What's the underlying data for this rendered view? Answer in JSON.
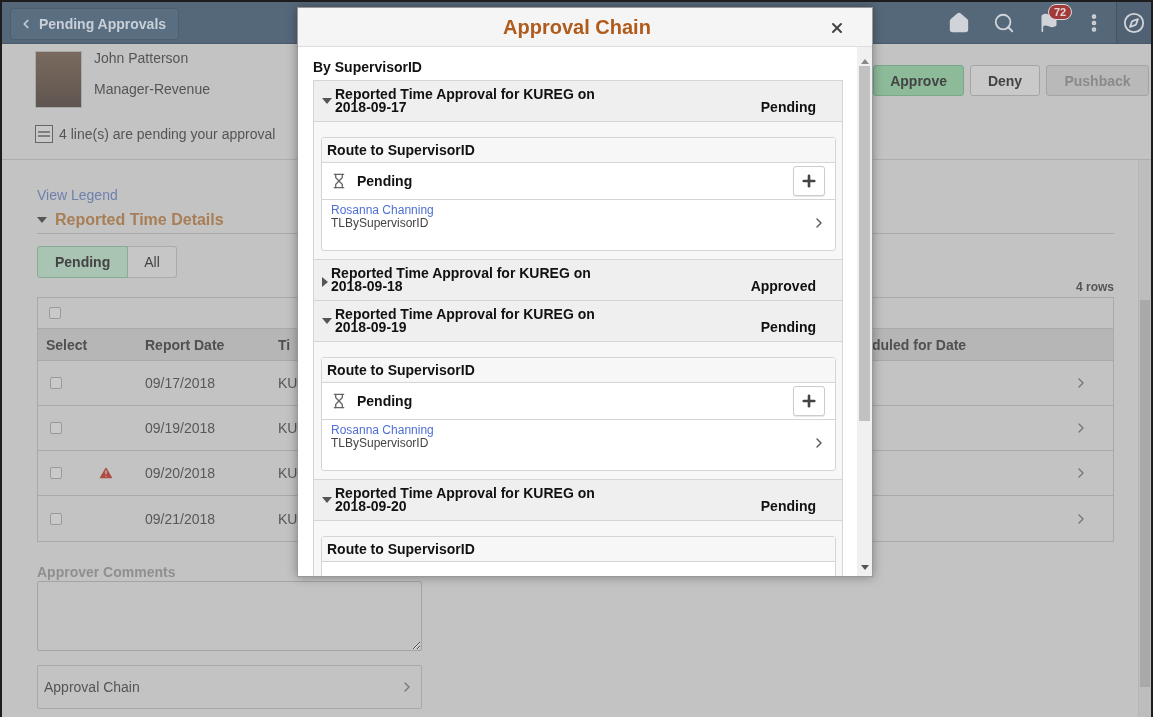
{
  "header": {
    "back_label": "Pending Approvals",
    "notification_count": "72"
  },
  "employee": {
    "name": "John Patterson",
    "title": "Manager-Revenue"
  },
  "actions": [
    {
      "label": "Approve",
      "kind": "primary"
    },
    {
      "label": "Deny",
      "kind": "default"
    },
    {
      "label": "Pushback",
      "kind": "disabled"
    }
  ],
  "pending_note": "4 line(s) are pending your approval",
  "legend_link": "View Legend",
  "section": {
    "title": "Reported Time Details",
    "expanded": true
  },
  "filter": [
    {
      "label": "Pending",
      "selected": true
    },
    {
      "label": "All",
      "selected": false
    }
  ],
  "row_count": "4 rows",
  "table": {
    "all_checked": false,
    "columns": [
      "Select",
      "Report Date",
      "Ti",
      "duled for Date"
    ],
    "rows": [
      {
        "checked": false,
        "warning": false,
        "report_date": "09/17/2018",
        "column_3": "KU"
      },
      {
        "checked": false,
        "warning": false,
        "report_date": "09/19/2018",
        "column_3": "KU"
      },
      {
        "checked": false,
        "warning": true,
        "report_date": "09/20/2018",
        "column_3": "KU"
      },
      {
        "checked": false,
        "warning": false,
        "report_date": "09/21/2018",
        "column_3": "KU"
      }
    ]
  },
  "comments": {
    "label": "Approver Comments"
  },
  "approval_chain_link": "Approval Chain",
  "modal": {
    "title": "Approval Chain",
    "subtitle": "By SupervisorID",
    "groups": [
      {
        "title": "Reported Time Approval for KUREG on 2018-09-17",
        "status": "Pending",
        "expanded": true,
        "route": "Route to SupervisorID",
        "step": {
          "status": "Pending",
          "approver": "Rosanna Channing",
          "role": "TLBySupervisorID"
        }
      },
      {
        "title": "Reported Time Approval for KUREG on 2018-09-18",
        "status": "Approved",
        "expanded": false
      },
      {
        "title": "Reported Time Approval for KUREG on 2018-09-19",
        "status": "Pending",
        "expanded": true,
        "route": "Route to SupervisorID",
        "step": {
          "status": "Pending",
          "approver": "Rosanna Channing",
          "role": "TLBySupervisorID"
        }
      },
      {
        "title": "Reported Time Approval for KUREG on 2018-09-20",
        "status": "Pending",
        "expanded": true,
        "route": "Route to SupervisorID"
      }
    ]
  }
}
